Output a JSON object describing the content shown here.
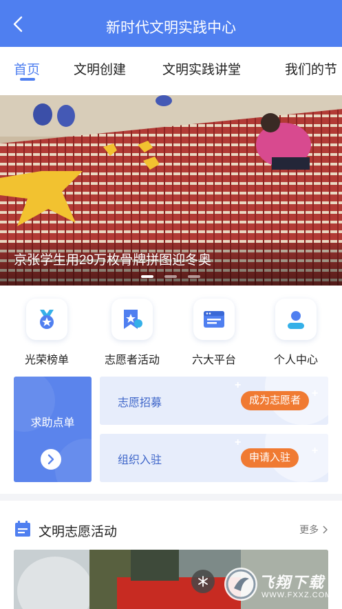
{
  "header": {
    "title": "新时代文明实践中心",
    "back_icon": "chevron-left-icon"
  },
  "tabs": [
    {
      "label": "首页",
      "active": true
    },
    {
      "label": "文明创建",
      "active": false
    },
    {
      "label": "文明实践讲堂",
      "active": false
    },
    {
      "label": "我们的节",
      "active": false
    }
  ],
  "banner": {
    "caption": "京张学生用29万枚骨牌拼图迎冬奥",
    "slide_count": 3,
    "active_slide": 1
  },
  "quick_links": [
    {
      "label": "光荣榜单",
      "icon": "medal-icon"
    },
    {
      "label": "志愿者活动",
      "icon": "bookmark-star-icon"
    },
    {
      "label": "六大平台",
      "icon": "browser-window-icon"
    },
    {
      "label": "个人中心",
      "icon": "user-profile-icon"
    }
  ],
  "help_card": {
    "label": "求助点单",
    "icon": "chevron-right-icon"
  },
  "actions": [
    {
      "label": "志愿招募",
      "button": "成为志愿者"
    },
    {
      "label": "组织入驻",
      "button": "申请入驻"
    }
  ],
  "section": {
    "title": "文明志愿活动",
    "more": "更多",
    "icon": "calendar-icon"
  },
  "watermark": {
    "text": "飞翔下载",
    "url": "WWW.FXXZ.COM"
  },
  "colors": {
    "primary": "#4f7ff0",
    "accent": "#f07a32",
    "card_bg": "#e7edfb"
  }
}
